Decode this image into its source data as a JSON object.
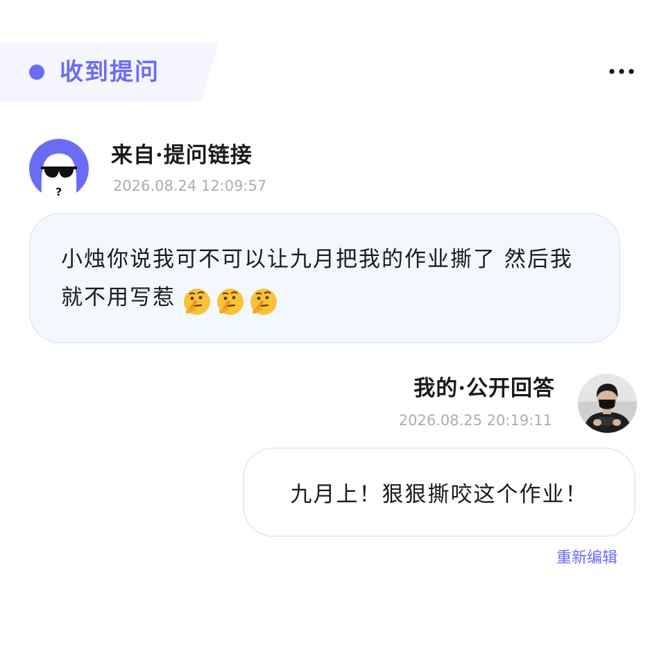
{
  "header": {
    "title": "收到提问",
    "more_icon": "more-horizontal-icon",
    "accent_color": "#6a6cf4"
  },
  "question": {
    "sender_label": "来自·提问链接",
    "timestamp": "2026.08.24 12:09:57",
    "avatar_icon": "anonymous-sunglasses-avatar",
    "text": "小烛你说我可不可以让九月把我的作业撕了 然后我就不用写惹",
    "emojis": [
      "thinking-face",
      "thinking-face",
      "thinking-face"
    ]
  },
  "answer": {
    "sender_label": "我的·公开回答",
    "timestamp": "2026.08.25 20:19:11",
    "text": "九月上！狠狠撕咬这个作业！"
  },
  "actions": {
    "reedit_label": "重新编辑"
  }
}
